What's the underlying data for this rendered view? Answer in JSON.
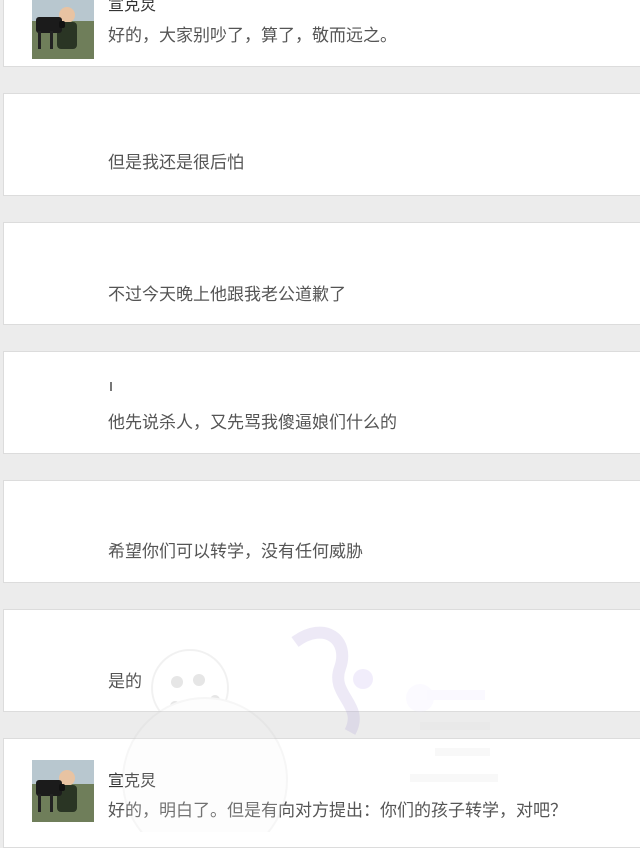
{
  "messages": [
    {
      "name": "宣克炅",
      "text": "好的，大家别吵了，算了，敬而远之。"
    },
    {
      "text": "但是我还是很后怕"
    },
    {
      "text": "不过今天晚上他跟我老公道歉了"
    },
    {
      "text": "他先说杀人，又先骂我傻逼娘们什么的"
    },
    {
      "text": "希望你们可以转学，没有任何威胁"
    },
    {
      "text": "是的"
    },
    {
      "name": "宣克炅",
      "text": "好的，明白了。但是有向对方提出：你们的孩子转学，对吧？"
    }
  ],
  "colors": {
    "card": "#ffffff",
    "background": "#ececec",
    "text": "#555555",
    "border": "#dcdcdc"
  },
  "icons": [
    "avatar-photo"
  ]
}
